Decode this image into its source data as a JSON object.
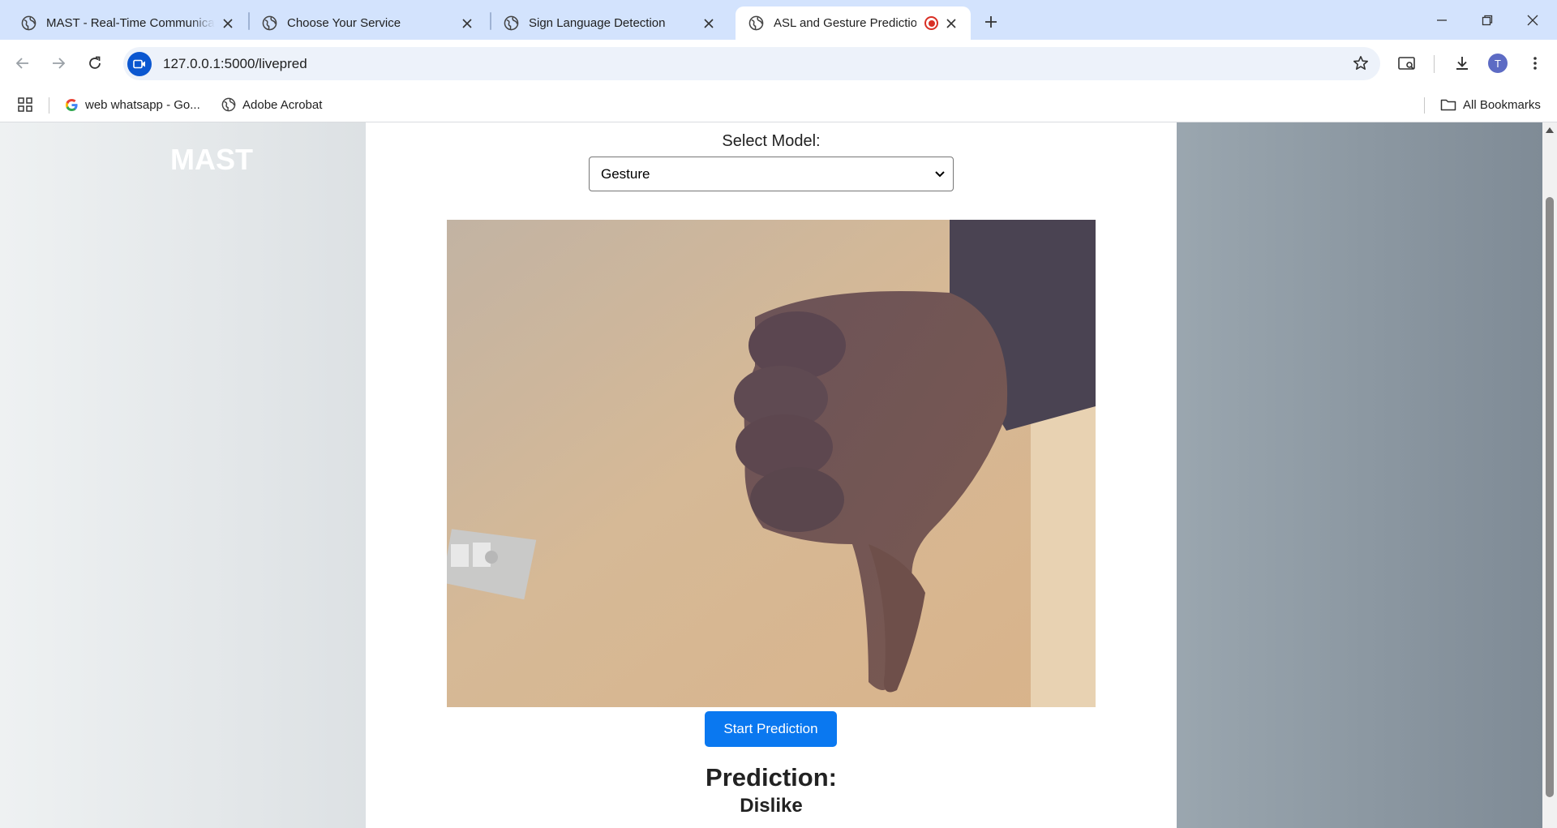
{
  "browser": {
    "tabs": [
      {
        "title": "MAST - Real-Time Communicat",
        "icon": "globe-icon"
      },
      {
        "title": "Choose Your Service",
        "icon": "globe-icon"
      },
      {
        "title": "Sign Language Detection",
        "icon": "globe-icon"
      },
      {
        "title": "ASL and Gesture Prediction",
        "icon": "globe-icon",
        "active": true,
        "recording": true
      }
    ],
    "url": "127.0.0.1:5000/livepred",
    "avatar_initial": "T",
    "bookmarks": [
      {
        "label": "web whatsapp - Go...",
        "icon": "google-icon"
      },
      {
        "label": "Adobe Acrobat",
        "icon": "globe-icon"
      }
    ],
    "all_bookmarks_label": "All Bookmarks"
  },
  "page": {
    "brand": "MAST",
    "select_label": "Select Model:",
    "model_selected": "Gesture",
    "start_button": "Start Prediction",
    "prediction_heading": "Prediction:",
    "prediction_value": "Dislike"
  },
  "colors": {
    "tabstrip": "#d3e3fd",
    "primary_button": "#0a78f0",
    "recording": "#d93025"
  }
}
